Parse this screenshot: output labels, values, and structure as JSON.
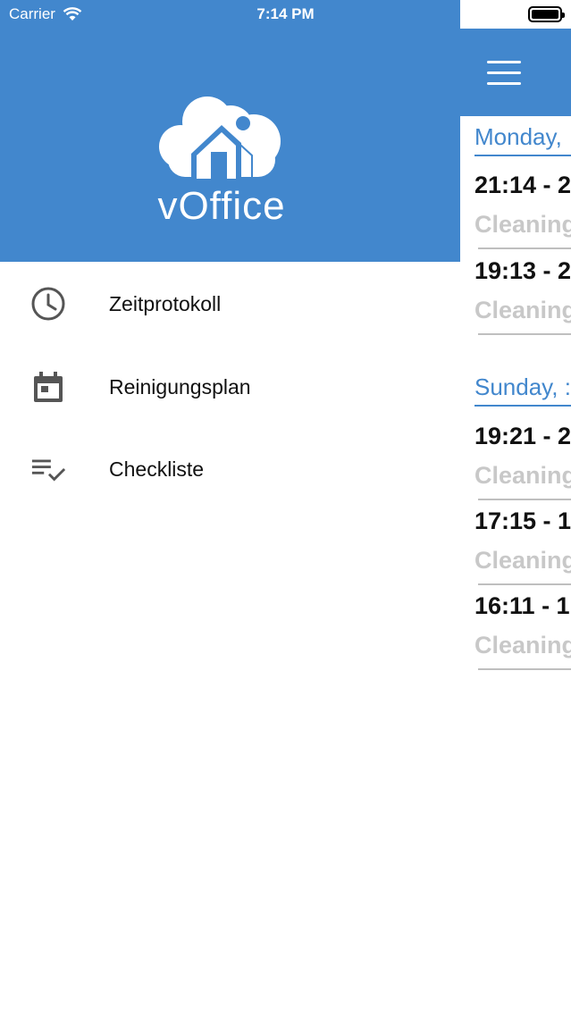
{
  "status_bar": {
    "carrier": "Carrier",
    "time": "7:14 PM"
  },
  "drawer": {
    "logo_text": "vOffice",
    "menu": [
      {
        "label": "Zeitprotokoll",
        "icon": "clock-icon"
      },
      {
        "label": "Reinigungsplan",
        "icon": "calendar-icon"
      },
      {
        "label": "Checkliste",
        "icon": "checklist-icon"
      }
    ]
  },
  "main": {
    "groups": [
      {
        "day": "Monday,",
        "entries": [
          {
            "time": "21:14 - 2",
            "task": "Cleaning"
          },
          {
            "time": "19:13 - 2",
            "task": "Cleaning"
          }
        ]
      },
      {
        "day": "Sunday, :",
        "entries": [
          {
            "time": "19:21 - 2",
            "task": "Cleaning"
          },
          {
            "time": "17:15 - 1",
            "task": "Cleaning"
          },
          {
            "time": "16:11 - 1",
            "task": "Cleaning"
          }
        ]
      }
    ]
  },
  "colors": {
    "brand_blue": "#4287cd",
    "muted_text": "#c8c8c8"
  }
}
